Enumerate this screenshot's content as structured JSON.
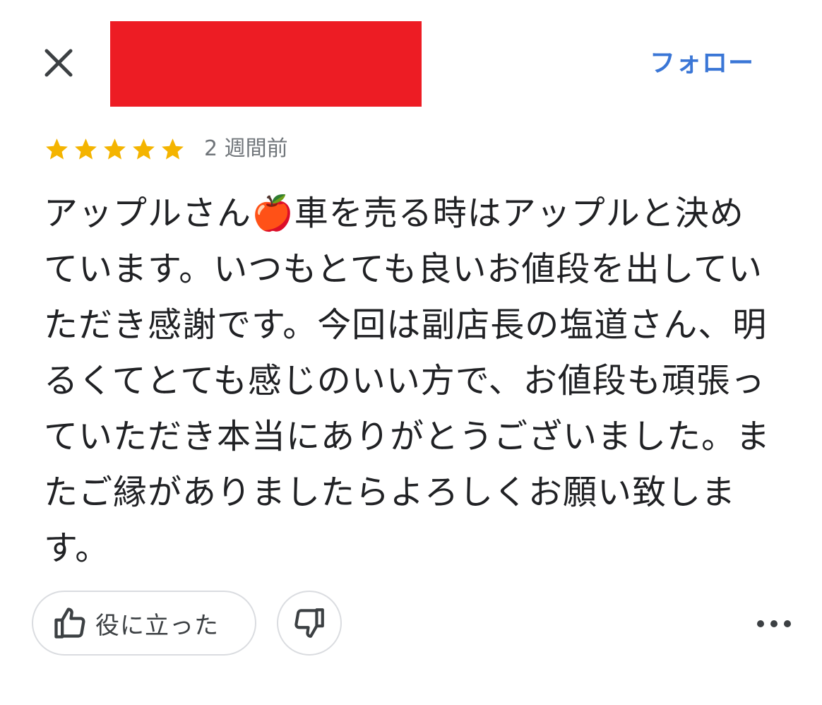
{
  "header": {
    "close_icon": "close-icon",
    "follow_label": "フォロー",
    "redaction_color": "#ed1c24"
  },
  "review": {
    "rating": 5,
    "rating_max": 5,
    "star_color": "#f4b400",
    "time_ago": "2 週間前",
    "text": "アップルさん🍎車を売る時はアップルと決めています。いつもとても良いお値段を出していただき感謝です。今回は副店長の塩道さん、明るくてとても感じのいい方で、お値段も頑張っていただき本当にありがとうございました。またご縁がありましたらよろしくお願い致します。"
  },
  "actions": {
    "helpful_label": "役に立った",
    "helpful_icon": "thumbs-up-icon",
    "unhelpful_icon": "thumbs-down-icon",
    "more_icon": "more-horizontal-icon"
  },
  "colors": {
    "accent": "#3a76d6",
    "text": "#202124",
    "secondary_text": "#70757a",
    "border": "#dadce0"
  }
}
